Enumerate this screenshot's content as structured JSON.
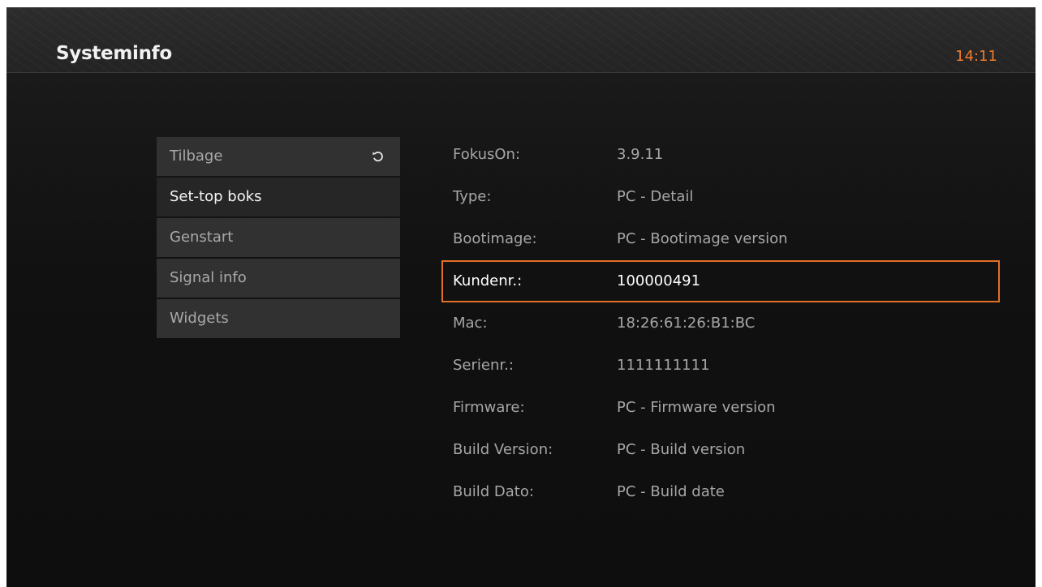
{
  "header": {
    "title": "Systeminfo",
    "clock": "14:11"
  },
  "menu": {
    "items": [
      {
        "label": "Tilbage",
        "icon": "refresh-icon"
      },
      {
        "label": "Set-top boks"
      },
      {
        "label": "Genstart"
      },
      {
        "label": "Signal info"
      },
      {
        "label": "Widgets"
      }
    ],
    "active_index": 1
  },
  "info": {
    "rows": [
      {
        "label": "FokusOn:",
        "value": "3.9.11"
      },
      {
        "label": "Type:",
        "value": "PC - Detail"
      },
      {
        "label": "Bootimage:",
        "value": "PC - Bootimage version"
      },
      {
        "label": "Kundenr.:",
        "value": "100000491"
      },
      {
        "label": "Mac:",
        "value": "18:26:61:26:B1:BC"
      },
      {
        "label": "Serienr.:",
        "value": "1111111111"
      },
      {
        "label": "Firmware:",
        "value": "PC - Firmware version"
      },
      {
        "label": "Build Version:",
        "value": "PC - Build version"
      },
      {
        "label": "Build Dato:",
        "value": "PC - Build date"
      }
    ],
    "selected_index": 3
  },
  "colors": {
    "accent": "#f07a2a",
    "selection_border": "#e0702a",
    "background": "#141414",
    "menu_item": "#313131",
    "menu_item_active": "#262626"
  }
}
